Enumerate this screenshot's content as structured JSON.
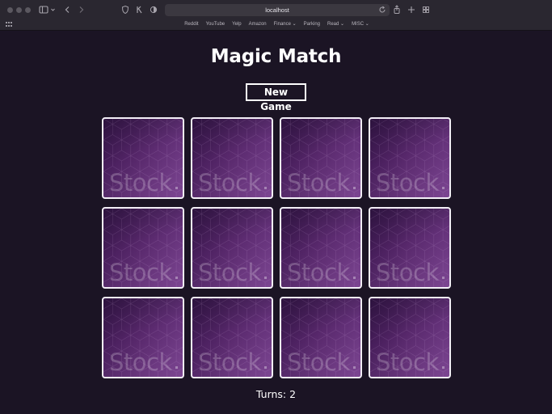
{
  "browser": {
    "address": "localhost",
    "bookmarks": [
      {
        "label": "Reddit"
      },
      {
        "label": "YouTube"
      },
      {
        "label": "Yelp"
      },
      {
        "label": "Amazon"
      },
      {
        "label": "Finance ⌄"
      },
      {
        "label": "Parking"
      },
      {
        "label": "Read ⌄"
      },
      {
        "label": "MISC ⌄"
      }
    ]
  },
  "game": {
    "title": "Magic Match",
    "new_game_label": "New Game",
    "turns_label": "Turns: 2",
    "card_back_text": "Stock",
    "card_back_colors": [
      "#4a1f5e",
      "#6a3580"
    ],
    "cards": [
      {
        "face": "down"
      },
      {
        "face": "down"
      },
      {
        "face": "down"
      },
      {
        "face": "down"
      },
      {
        "face": "down"
      },
      {
        "face": "down"
      },
      {
        "face": "down"
      },
      {
        "face": "down"
      },
      {
        "face": "down"
      },
      {
        "face": "down"
      },
      {
        "face": "down"
      },
      {
        "face": "down"
      }
    ]
  }
}
